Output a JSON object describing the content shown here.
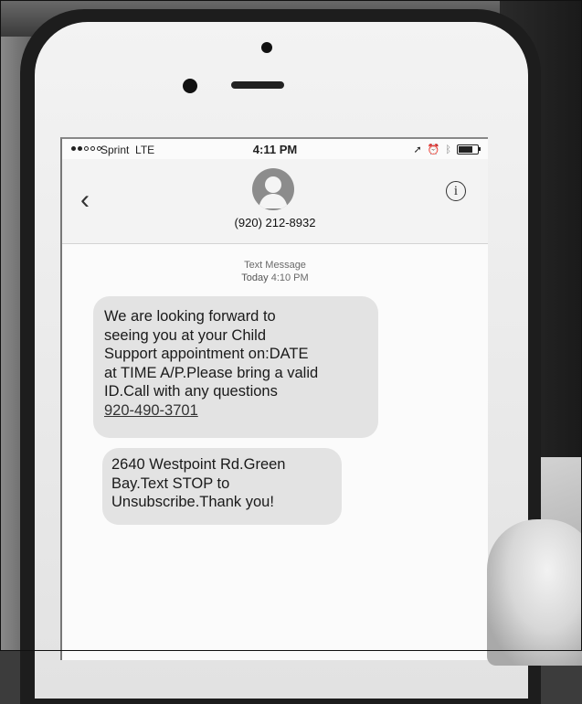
{
  "status_bar": {
    "carrier": "Sprint",
    "network": "LTE",
    "time": "4:11 PM"
  },
  "header": {
    "contact": "(920) 212-8932",
    "info_glyph": "i",
    "back_glyph": "‹"
  },
  "thread": {
    "service_label": "Text Message",
    "day": "Today",
    "time": "4:10 PM"
  },
  "messages": [
    {
      "lines": [
        "We are looking forward to",
        "seeing you at your Child",
        "Support appointment on:DATE",
        "at TIME A/P.Please bring a valid",
        "ID.Call with any questions"
      ],
      "link": "920-490-3701"
    },
    {
      "lines": [
        "2640 Westpoint Rd.Green",
        "Bay.Text STOP to",
        "Unsubscribe.Thank you!"
      ]
    }
  ],
  "icons": {
    "back": "chevron-left-icon",
    "avatar": "person-silhouette-icon",
    "info": "info-icon",
    "location": "location-arrow-icon",
    "alarm": "alarm-icon",
    "bluetooth": "bluetooth-icon",
    "battery": "battery-icon"
  },
  "colors": {
    "bubble": "#e3e3e3",
    "screen": "#fbfbfb",
    "text": "#1a1a1a"
  }
}
